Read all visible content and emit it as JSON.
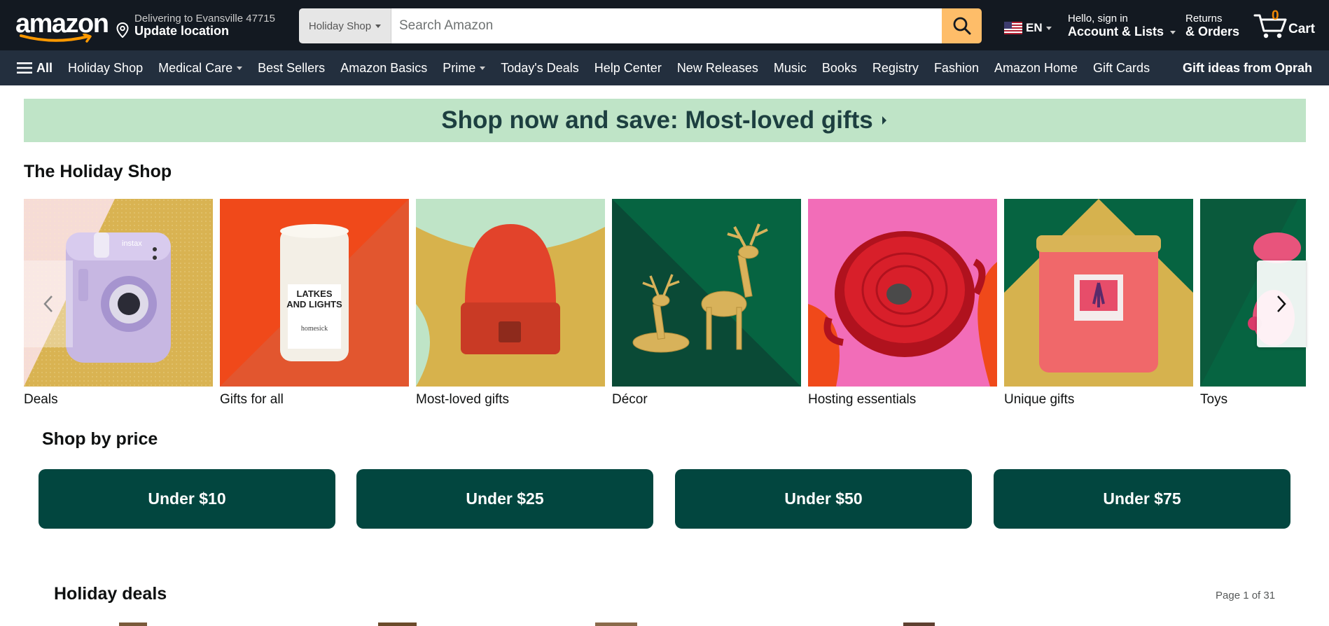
{
  "header": {
    "logo_text": "amazon",
    "deliver_line1": "Delivering to Evansville 47715",
    "deliver_line2": "Update location",
    "search_department": "Holiday Shop",
    "search_placeholder": "Search Amazon",
    "language": "EN",
    "account_line1": "Hello, sign in",
    "account_line2": "Account & Lists",
    "returns_line1": "Returns",
    "returns_line2": "& Orders",
    "cart_count": "0",
    "cart_label": "Cart"
  },
  "subnav": {
    "all_label": "All",
    "items": [
      {
        "label": "Holiday Shop",
        "dropdown": false
      },
      {
        "label": "Medical Care",
        "dropdown": true
      },
      {
        "label": "Best Sellers",
        "dropdown": false
      },
      {
        "label": "Amazon Basics",
        "dropdown": false
      },
      {
        "label": "Prime",
        "dropdown": true
      },
      {
        "label": "Today's Deals",
        "dropdown": false
      },
      {
        "label": "Help Center",
        "dropdown": false
      },
      {
        "label": "New Releases",
        "dropdown": false
      },
      {
        "label": "Music",
        "dropdown": false
      },
      {
        "label": "Books",
        "dropdown": false
      },
      {
        "label": "Registry",
        "dropdown": false
      },
      {
        "label": "Fashion",
        "dropdown": false
      },
      {
        "label": "Amazon Home",
        "dropdown": false
      },
      {
        "label": "Gift Cards",
        "dropdown": false
      }
    ],
    "promo": "Gift ideas from Oprah"
  },
  "banner": {
    "text": "Shop now and save: Most-loved gifts"
  },
  "holiday_shop": {
    "title": "The Holiday Shop",
    "cards": [
      {
        "label": "Deals"
      },
      {
        "label": "Gifts for all"
      },
      {
        "label": "Most-loved gifts"
      },
      {
        "label": "Décor"
      },
      {
        "label": "Hosting essentials"
      },
      {
        "label": "Unique gifts"
      },
      {
        "label": "Toys"
      }
    ],
    "candle_text_1": "LATKES",
    "candle_text_2": "AND LIGHTS",
    "candle_brand": "homesick",
    "camera_brand": "instax"
  },
  "shop_by_price": {
    "title": "Shop by price",
    "buttons": [
      {
        "label": "Under $10"
      },
      {
        "label": "Under $25"
      },
      {
        "label": "Under $50"
      },
      {
        "label": "Under $75"
      }
    ]
  },
  "holiday_deals": {
    "title": "Holiday deals",
    "page_indicator": "Page 1 of 31"
  },
  "colors": {
    "nav_dark": "#131921",
    "subnav": "#232f3e",
    "search_button": "#febd69",
    "banner_bg": "#bfe4c7",
    "price_button": "#02463f",
    "cart_count": "#f08804"
  }
}
